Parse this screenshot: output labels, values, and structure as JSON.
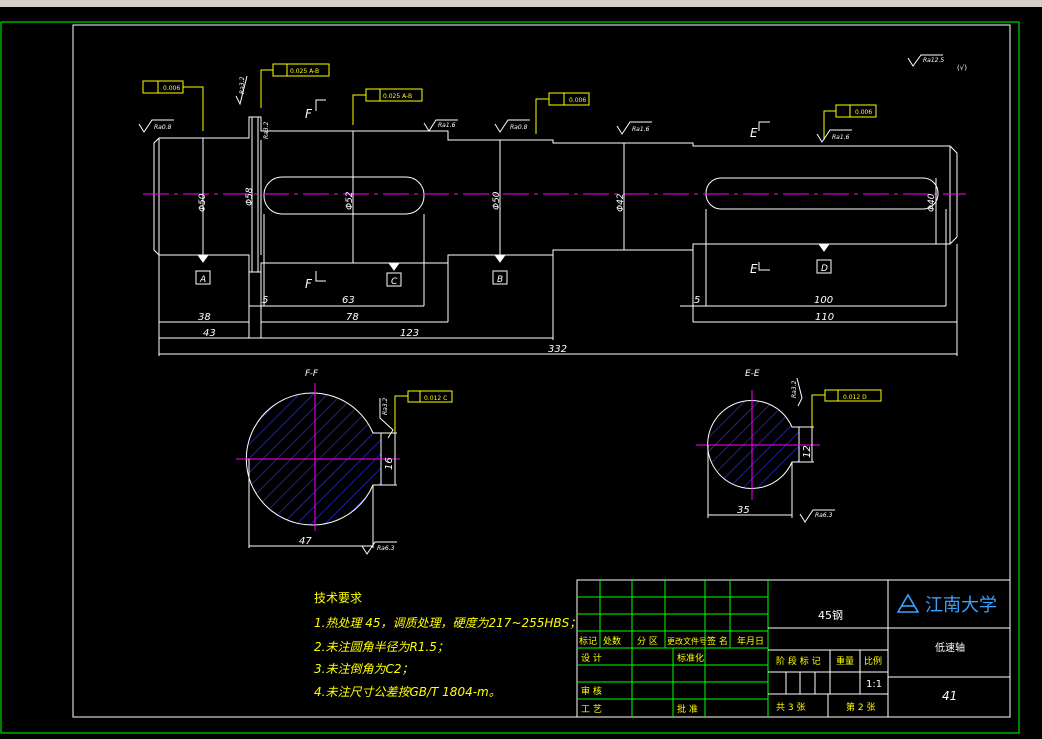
{
  "drawing": {
    "roughness_note": "Ra12.5",
    "roughness_note_suffix": "(√)",
    "dimensions": {
      "d38": "38",
      "d43": "43",
      "d78": "78",
      "d123": "123",
      "d332": "332",
      "d5a": "5",
      "d63": "63",
      "d5b": "5",
      "d100": "100",
      "d110": "110"
    },
    "diameters": {
      "phi50a": "Φ50",
      "phi58": "Φ58",
      "phi52": "Φ52",
      "phi50b": "Φ50",
      "phi42": "Φ42",
      "phi40": "Φ40"
    },
    "datums": {
      "A": "A",
      "B": "B",
      "C": "C",
      "D": "D"
    },
    "section_marks": {
      "F1": "F",
      "F2": "F",
      "E1": "E",
      "E2": "E"
    },
    "tolerance_frames": {
      "runout1": "0.006",
      "runout2": "0.025 A-B",
      "runout3": "0.025 A-B",
      "runout4": "0.006",
      "runout5": "0.006",
      "sym1": "0.012 C",
      "sym2": "0.012 D"
    },
    "roughness": {
      "r1": "Ra0.8",
      "r2": "Ra3.2",
      "r3": "Ra1.6",
      "r4": "Ra0.8",
      "r5": "Ra1.6",
      "r6": "Ra1.6",
      "r7": "Ra3.2",
      "r8": "Ra6.3",
      "r9": "Ra3.2",
      "r10": "Ra6.3",
      "r11": "Ra3.2"
    },
    "sections": {
      "ff_title": "F-F",
      "ee_title": "E-E",
      "ff_width": "47",
      "ee_width": "35",
      "ff_key": "16",
      "ee_key": "12"
    },
    "tech": {
      "title": "技术要求",
      "l1": "1.热处理 45，调质处理，硬度为217~255HBS；",
      "l2": "2.未注圆角半径为R1.5；",
      "l3": "3.未注倒角为C2；",
      "l4": "4.未注尺寸公差按GB/T 1804-m。"
    }
  },
  "title_block": {
    "material": "45钢",
    "university": "江南大学",
    "part_name": "低速轴",
    "drawing_no": "41",
    "scale": "1:1",
    "h_mark": "标记",
    "h_count": "处数",
    "h_zone": "分 区",
    "h_doc": "更改文件号",
    "h_sign": "签 名",
    "h_date": "年月日",
    "h_design": "设 计",
    "h_std": "标准化",
    "h_stage": "阶 段 标 记",
    "h_weight": "重量",
    "h_scale": "比例",
    "h_review": "审 核",
    "h_process": "工 艺",
    "h_approve": "批 准",
    "sheets_total": "共 3 张",
    "sheet_no": "第 2 张"
  },
  "colors": {
    "line": "#ffffff",
    "center": "#ff00ff",
    "frame": "#00ff00",
    "annot": "#ffff00",
    "hatch": "#3333ff",
    "bg": "#000000"
  }
}
